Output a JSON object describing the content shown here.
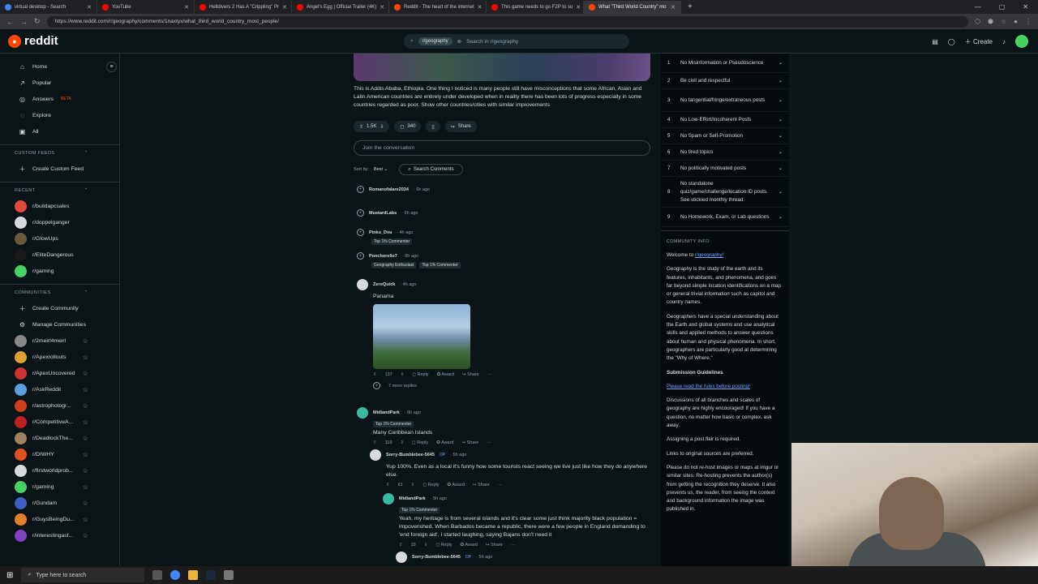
{
  "browser": {
    "tabs": [
      {
        "title": "virtual desktop - Search",
        "color": "#4285f4"
      },
      {
        "title": "YouTube",
        "color": "#ff0000"
      },
      {
        "title": "Helldivers 2 Has A \"Crippling\" Pr",
        "color": "#ff0000"
      },
      {
        "title": "Angel's Egg | Official Trailer (4K)",
        "color": "#ff0000"
      },
      {
        "title": "Reddit - The heart of the internet",
        "color": "#ff4500"
      },
      {
        "title": "This game needs to go F2P to su",
        "color": "#ff0000"
      },
      {
        "title": "What \"Third World Country\" mo",
        "color": "#ff4500",
        "active": true
      }
    ],
    "url": "https://www.reddit.com/r/geography/comments/1naxtyx/what_third_world_country_most_people/"
  },
  "header": {
    "logo_text": "reddit",
    "search_chip": "r/geography",
    "search_placeholder": "Search in r/geography",
    "create_label": "Create"
  },
  "sidebar": {
    "nav": [
      {
        "label": "Home",
        "icon": "home-icon",
        "glyph": "⌂"
      },
      {
        "label": "Popular",
        "icon": "popular-icon",
        "glyph": "↗"
      },
      {
        "label": "Answers",
        "icon": "answers-icon",
        "glyph": "◎",
        "badge": "BETA"
      },
      {
        "label": "Explore",
        "icon": "explore-icon",
        "glyph": "◌"
      },
      {
        "label": "All",
        "icon": "all-icon",
        "glyph": "▣"
      }
    ],
    "custom_feeds_title": "CUSTOM FEEDS",
    "create_feed": "Create Custom Feed",
    "recent_title": "RECENT",
    "recent": [
      {
        "label": "r/buildapcsales",
        "color": "#e04a3a"
      },
      {
        "label": "r/doppelganger",
        "color": "#d7dadc"
      },
      {
        "label": "r/GlowUps",
        "color": "#6b5a3a"
      },
      {
        "label": "r/EliteDangerous",
        "color": "#1a1a1a"
      },
      {
        "label": "r/gaming",
        "color": "#46d160"
      }
    ],
    "communities_title": "COMMUNITIES",
    "create_community": "Create Community",
    "manage_communities": "Manage Communities",
    "communities": [
      {
        "label": "r/2meirl4meirl",
        "color": "#888888"
      },
      {
        "label": "r/Apexrollouts",
        "color": "#e0a030"
      },
      {
        "label": "r/ApexUncovered",
        "color": "#cc3333"
      },
      {
        "label": "r/AskReddit",
        "color": "#5aa0e0"
      },
      {
        "label": "r/astrophotogr...",
        "color": "#d04020"
      },
      {
        "label": "r/CompetitiveA...",
        "color": "#c02020"
      },
      {
        "label": "r/DeadlockThe...",
        "color": "#a08060"
      },
      {
        "label": "r/DIWHY",
        "color": "#e05020"
      },
      {
        "label": "r/firstworldprob...",
        "color": "#d7dadc"
      },
      {
        "label": "r/gaming",
        "color": "#46d160"
      },
      {
        "label": "r/Gundam",
        "color": "#4060c0"
      },
      {
        "label": "r/GuysBeingDu...",
        "color": "#e08030"
      },
      {
        "label": "r/interestingasf...",
        "color": "#8040c0"
      }
    ]
  },
  "post": {
    "text": "This is Addis Ababa, Ethiopia. One thing I noticed is many people still have misconceptions that some African, Asian and Latin American countries are entirely under developed when in reality there has been lots of progress especially in some countries regarded as poor. Show other countries/cities with similar improvements",
    "votes": "1.5K",
    "comments": "340",
    "share": "Share",
    "join_placeholder": "Join the conversation",
    "sort_label": "Sort by:",
    "sort_value": "Best",
    "search_comments": "Search Comments"
  },
  "comments": [
    {
      "user": "Romanofalare2034",
      "time": "· 6h ago"
    },
    {
      "user": "MustardLabs",
      "time": "· 6h ago"
    },
    {
      "user": "Pinku_Dva",
      "time": "· 4h ago",
      "flair": "Top 1% Commenter"
    },
    {
      "user": "Ponchorello7",
      "time": "· 6h ago",
      "flair": "Geography Enthusiast",
      "flair2": "Top 1% Commenter"
    },
    {
      "user": "ZeroQuick",
      "time": "· 4h ago",
      "text": "Panama",
      "votes": "137",
      "more": "7 more replies"
    },
    {
      "user": "MidlandPark",
      "time": "· 6h ago",
      "flair": "Top 1% Commenter",
      "text": "Many Caribbean Islands",
      "votes": "119"
    },
    {
      "user": "Sorry-Bumblebee-5645",
      "time": "· 5h ago",
      "op": "OP",
      "text": "Yup 100%. Even as a local it's funny how some tourists react seeing we live just like how they do anywhere else.",
      "votes": "61"
    },
    {
      "user": "MidlandPark",
      "time": "· 5h ago",
      "flair": "Top 1% Commenter",
      "text": "Yeah, my heritage is from several islands and it's clear some just think majority black population = impoverished. When Barbados became a republic, there were a few people in England demanding to 'end foreign aid'. I started laughing, saying Bajans don't need it",
      "votes": "33"
    },
    {
      "user": "Sorry-Bumblebee-5645",
      "time": "· 5h ago",
      "op": "OP"
    }
  ],
  "comment_actions": {
    "reply": "Reply",
    "award": "Award",
    "share": "Share"
  },
  "rules": [
    {
      "n": "1",
      "text": "No Misinformation or Pseudoscience"
    },
    {
      "n": "2",
      "text": "Be civil and respectful"
    },
    {
      "n": "3",
      "text": "No tangential/fringe/extraneous posts"
    },
    {
      "n": "4",
      "text": "No Low-Effort/Incoherent Posts"
    },
    {
      "n": "5",
      "text": "No Spam or Self-Promotion"
    },
    {
      "n": "6",
      "text": "No tired topics"
    },
    {
      "n": "7",
      "text": "No politically motivated posts"
    },
    {
      "n": "8",
      "text": "No standalone quiz/game/challenge/location ID posts. See stickied monthly thread."
    },
    {
      "n": "9",
      "text": "No Homework, Exam, or Lab questions"
    }
  ],
  "community_info": {
    "title": "COMMUNITY INFO",
    "welcome_prefix": "Welcome to",
    "welcome_link": "r/geography!",
    "p1": "Geography is the study of the earth and its features, inhabitants, and phenomena, and goes far beyond simple location identifications on a map or general trivial information such as capitol and country names.",
    "p2": "Geographers have a special understanding about the Earth and global systems and use analytical skills and applied methods to answer questions about human and physical phenomena. In short, geographers are particularly good at determining the \"Why of Where.\"",
    "guidelines_title": "Submission Guidelines",
    "guidelines_link": "Please read the rules before posting!",
    "p3": "Discussions of all branches and scales of geography are highly encouraged! If you have a question, no matter how basic or complex, ask away.",
    "p4": "Assigning a post flair is required.",
    "p5": "Links to original sources are preferred.",
    "p6": "Please do not re-host images or maps at imgur or similar sites. Re-hosting prevents the author(s) from getting the recognition they deserve. It also prevents us, the reader, from seeing the context and background information the image was published in."
  },
  "taskbar": {
    "search_placeholder": "Type here to search"
  }
}
